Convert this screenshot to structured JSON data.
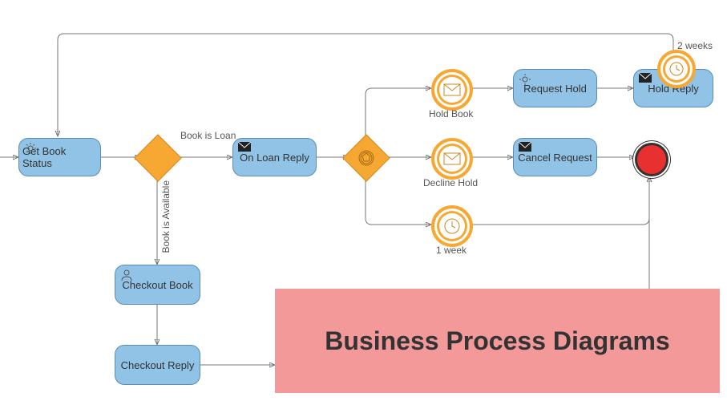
{
  "title_banner": "Business Process Diagrams",
  "tasks": {
    "get_book_status": "Get Book Status",
    "on_loan_reply": "On Loan Reply",
    "checkout_book": "Checkout Book",
    "checkout_reply": "Checkout Reply",
    "hold_book": "Hold Book",
    "decline_hold": "Decline Hold",
    "request_hold": "Request Hold",
    "hold_reply": "Hold Reply",
    "cancel_request": "Cancel Request"
  },
  "labels": {
    "book_is_loan": "Book is Loan",
    "book_is_available": "Book is Available",
    "one_week": "1 week",
    "two_weeks": "2 weeks"
  },
  "icons": {
    "gear": "gear-icon",
    "envelope_black": "envelope-black-icon",
    "envelope_open": "envelope-open-icon",
    "clock": "clock-icon",
    "user": "user-icon",
    "pentagon": "pentagon-icon"
  },
  "colors": {
    "task_fill": "#90c3e6",
    "task_border": "#5b8db3",
    "gateway_fill": "#f7a833",
    "event_end": "#e83030",
    "banner": "#f49999"
  }
}
